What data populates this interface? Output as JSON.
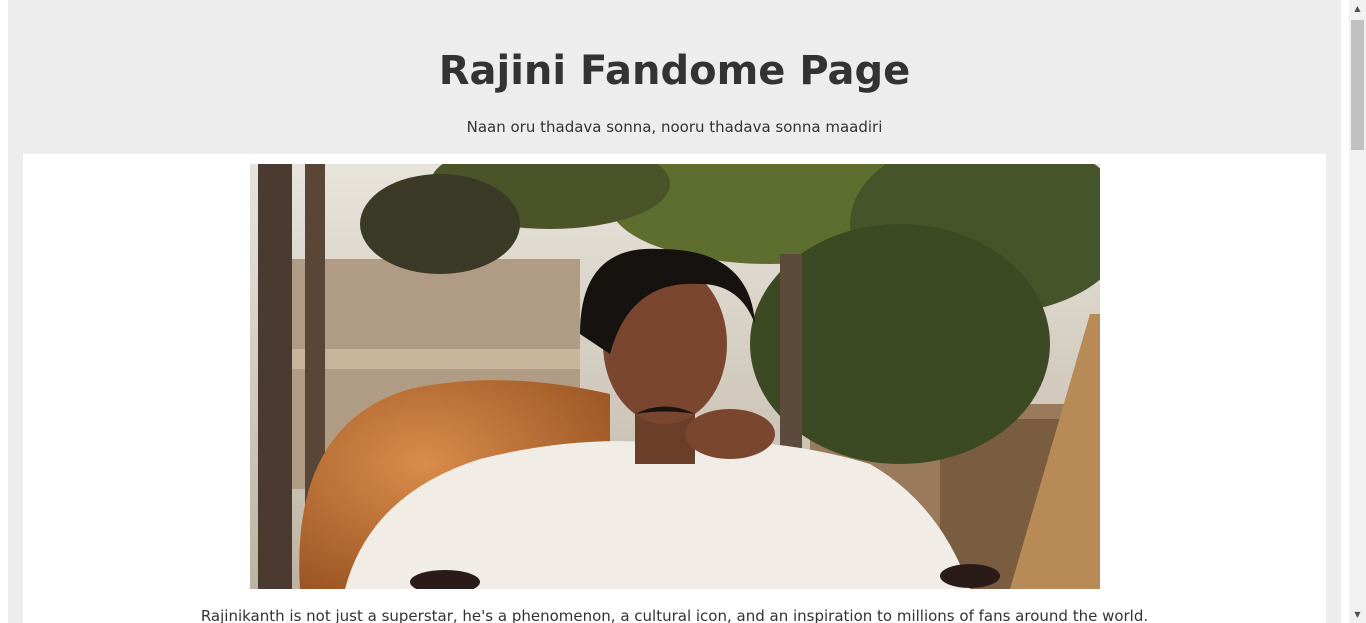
{
  "header": {
    "title": "Rajini Fandome Page",
    "tagline": "Naan oru thadava sonna, nooru thadava sonna maadiri"
  },
  "hero": {
    "image_alt": "Rajinikanth seated in an orange armchair in front of palm trees",
    "caption": "Rajinikanth is not just a superstar, he's a phenomenon, a cultural icon, and an inspiration to millions of fans around the world."
  },
  "scrollbar": {
    "up_icon": "scroll-up-arrow",
    "down_icon": "scroll-down-arrow"
  },
  "colors": {
    "page_background": "#ededed",
    "card_background": "#ffffff",
    "text": "#333333"
  }
}
